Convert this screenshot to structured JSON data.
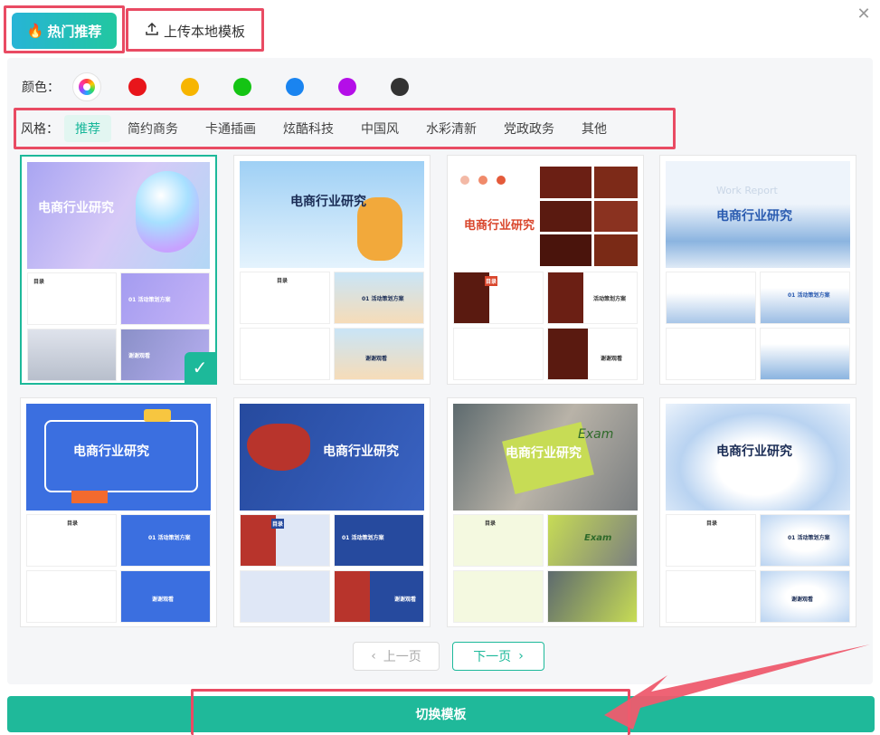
{
  "tabs": {
    "hot": "热门推荐",
    "upload": "上传本地模板"
  },
  "filters": {
    "color_label": "颜色：",
    "colors": [
      "#e8151b",
      "#f7b500",
      "#14c414",
      "#1a84f0",
      "#b40ee8",
      "#333333"
    ],
    "style_label": "风格：",
    "styles": [
      "推荐",
      "简约商务",
      "卡通插画",
      "炫酷科技",
      "中国风",
      "水彩清新",
      "党政政务",
      "其他"
    ],
    "active_style": "推荐"
  },
  "templates": [
    {
      "title": "电商行业研究",
      "thumb_left": "目录",
      "thumb_right": "01 活动策划方案",
      "thumb_end": "谢谢观看",
      "selected": true
    },
    {
      "title": "电商行业研究",
      "thumb_left": "目录",
      "thumb_right": "01 活动策划方案",
      "thumb_end": "谢谢观看",
      "selected": false
    },
    {
      "title": "电商行业研究",
      "thumb_left": "目录",
      "thumb_right": "活动策划方案",
      "thumb_end": "谢谢观看",
      "selected": false
    },
    {
      "title": "电商行业研究",
      "banner": "Work Report",
      "thumb_left": "",
      "thumb_right": "01 活动策划方案",
      "thumb_end": "",
      "selected": false
    },
    {
      "title": "电商行业研究",
      "thumb_left": "目录",
      "thumb_right": "01 活动策划方案",
      "thumb_end": "谢谢观看",
      "selected": false
    },
    {
      "title": "电商行业研究",
      "thumb_left": "目录",
      "thumb_right": "01 活动策划方案",
      "thumb_end": "谢谢观看",
      "selected": false
    },
    {
      "title": "电商行业研究",
      "banner": "Exam",
      "thumb_left": "目录",
      "thumb_right": "Exam",
      "thumb_end": "",
      "selected": false
    },
    {
      "title": "电商行业研究",
      "thumb_left": "目录",
      "thumb_right": "01 活动策划方案",
      "thumb_end": "谢谢观看",
      "selected": false
    }
  ],
  "pager": {
    "prev": "上一页",
    "next": "下一页"
  },
  "action": {
    "switch": "切换模板"
  },
  "accent_color": "#1db99a",
  "highlight_color": "#e94b63"
}
